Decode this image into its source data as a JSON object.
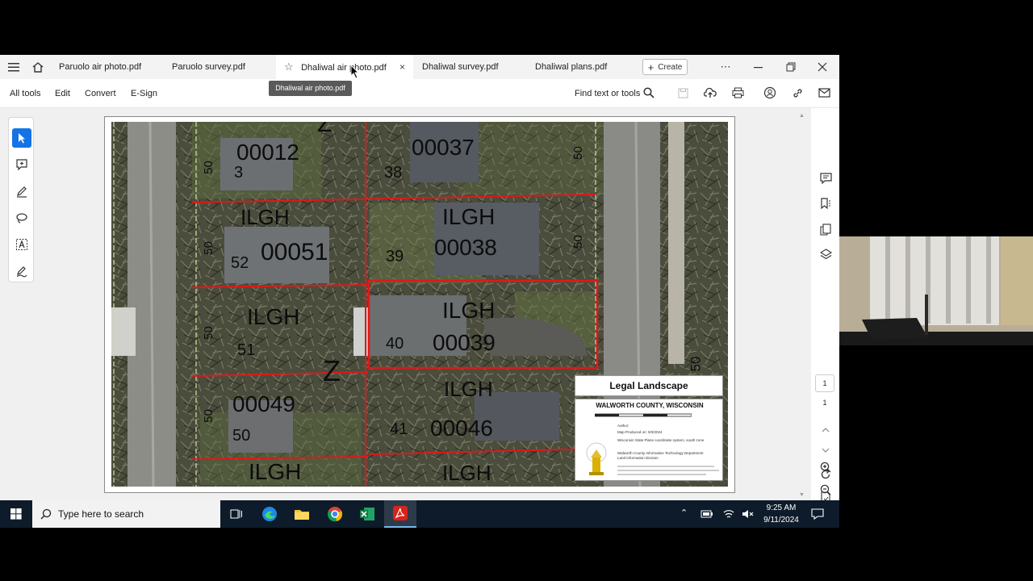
{
  "tabs": [
    {
      "label": "Paruolo air photo.pdf"
    },
    {
      "label": "Paruolo survey.pdf"
    },
    {
      "label": "Dhaliwal air photo.pdf"
    },
    {
      "label": "Dhaliwal survey.pdf"
    },
    {
      "label": "Dhaliwal plans.pdf"
    }
  ],
  "tooltip": "Dhaliwal air photo.pdf",
  "create_label": "Create",
  "menu": {
    "all_tools": "All tools",
    "edit": "Edit",
    "convert": "Convert",
    "esign": "E-Sign"
  },
  "find_label": "Find text or tools",
  "page_nav": {
    "current": "1",
    "total": "1"
  },
  "map": {
    "labels": {
      "p00012": "00012",
      "n3x": "3",
      "p00037": "00037",
      "n38": "38",
      "ilgh1": "ILGH",
      "ilgh2": "ILGH",
      "p00038": "00038",
      "n39": "39",
      "n52": "52",
      "p00051": "00051",
      "ilgh3": "ILGH",
      "ilgh4": "ILGH",
      "n40": "40",
      "p00039": "00039",
      "n51": "51",
      "z1": "Z",
      "z2": "Z",
      "p00049": "00049",
      "n50": "50",
      "n41": "41",
      "p00046": "00046",
      "ilgh5": "ILGH",
      "ilgh6": "ILGH",
      "ilgh7": "ILGH",
      "d50a": "50",
      "d50b": "50",
      "d50c": "50",
      "d50d": "50",
      "d50e": "50",
      "d50f": "50",
      "d50g": "50"
    },
    "legend": {
      "title": "Legal Landscape",
      "county": "WALWORTH COUNTY, WISCONSIN",
      "author": "Author:",
      "produced": "Map Produced on: 9/3/2024",
      "notes": "Wisconsin State Plane coordinate system, south zone",
      "dept": "Walworth County Information Technology Department",
      "division": "Land Information Division"
    }
  },
  "taskbar": {
    "search_placeholder": "Type here to search",
    "time": "9:25 AM",
    "date": "9/11/2024"
  }
}
